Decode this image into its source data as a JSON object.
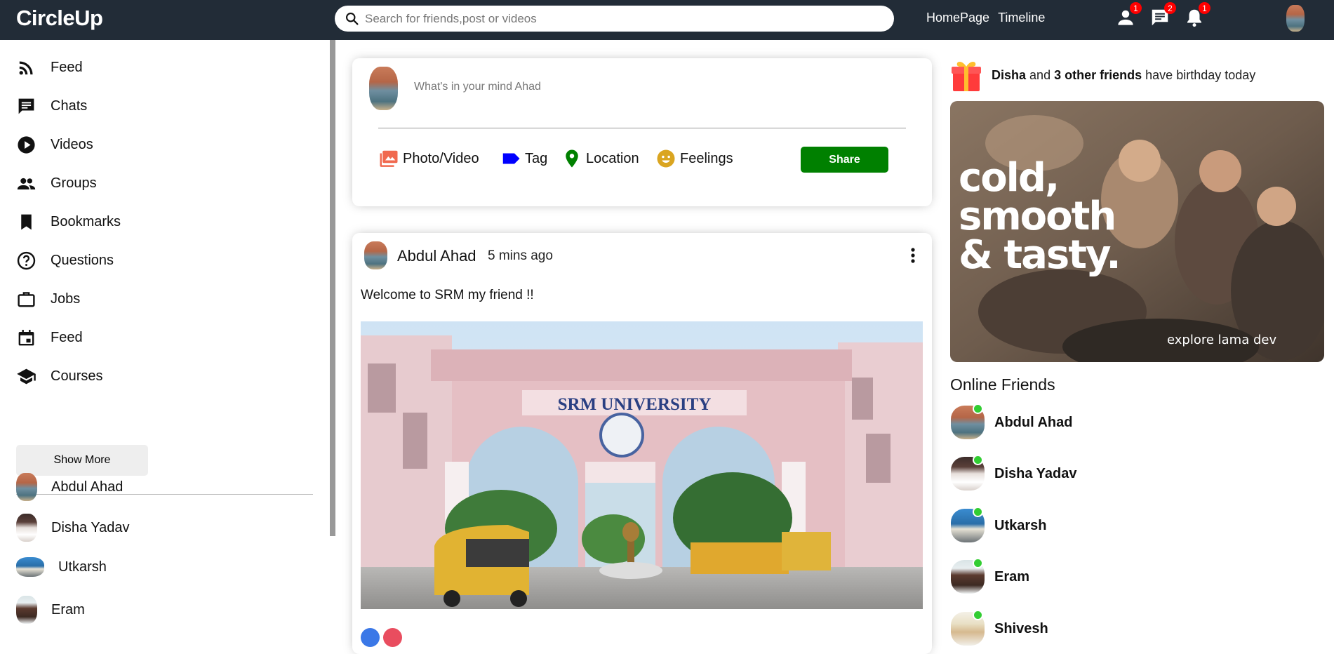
{
  "topbar": {
    "logo": "CircleUp",
    "search_placeholder": "Search for friends,post or videos",
    "links": [
      "HomePage",
      "Timeline"
    ],
    "badges": {
      "person": "1",
      "chat": "2",
      "notifications": "1"
    }
  },
  "sidebar": {
    "items": [
      {
        "label": "Feed",
        "icon": "rss-feed-icon"
      },
      {
        "label": "Chats",
        "icon": "chat-icon"
      },
      {
        "label": "Videos",
        "icon": "play-circle-icon"
      },
      {
        "label": "Groups",
        "icon": "group-icon"
      },
      {
        "label": "Bookmarks",
        "icon": "bookmark-icon"
      },
      {
        "label": "Questions",
        "icon": "help-circle-icon"
      },
      {
        "label": "Jobs",
        "icon": "work-icon"
      },
      {
        "label": "Feed",
        "icon": "event-icon"
      },
      {
        "label": "Courses",
        "icon": "school-icon"
      }
    ],
    "show_more": "Show More",
    "friends": [
      "Abdul Ahad",
      "Disha Yadav",
      "Utkarsh",
      "Eram"
    ]
  },
  "share": {
    "placeholder": "What's in your mind Ahad",
    "options": [
      "Photo/Video",
      "Tag",
      "Location",
      "Feelings"
    ],
    "button": "Share"
  },
  "post": {
    "user": "Abdul Ahad",
    "time": "5 mins ago",
    "text": "Welcome to SRM my friend !!",
    "image_sign": "SRM UNIVERSITY"
  },
  "rightbar": {
    "birthday": {
      "name": "Disha",
      "and": "and",
      "others": "3 other friends",
      "rest": "have birthday today"
    },
    "ad": {
      "headline": [
        "cold,",
        "smooth",
        "& tasty."
      ],
      "caption": "explore lama dev"
    },
    "online_title": "Online Friends",
    "online": [
      "Abdul Ahad",
      "Disha Yadav",
      "Utkarsh",
      "Eram",
      "Shivesh"
    ]
  },
  "colors": {
    "topbar": "#222c37",
    "share_button": "#008000",
    "online": "#32cd32",
    "badge": "#ff0000"
  }
}
